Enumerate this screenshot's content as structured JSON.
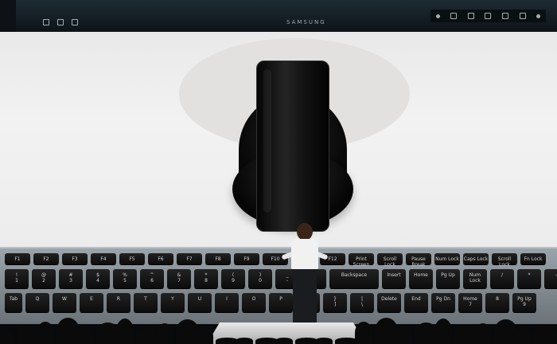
{
  "monitor": {
    "brand": "SAMSUNG"
  },
  "keyboard": {
    "function_row": [
      "F1",
      "F2",
      "F3",
      "F4",
      "F5",
      "F6",
      "F7",
      "F8",
      "F9",
      "F10",
      "F11",
      "F12",
      "Print Screen",
      "Scroll Lock",
      "Pause Break",
      "Num Lock",
      "Caps Lock",
      "Scroll Lock",
      "Fn Lock"
    ],
    "number_row": [
      "!\n1",
      "@\n2",
      "#\n3",
      "$\n4",
      "%\n5",
      "^\n6",
      "&\n7",
      "*\n8",
      "(\n9",
      ")\n0",
      "_\n-",
      "+\n=",
      "Backspace",
      "Insert",
      "Home",
      "Pg Up",
      "Num\nLock",
      "/",
      "*",
      "-"
    ],
    "letter_row": [
      "Tab",
      "Q",
      "W",
      "E",
      "R",
      "T",
      "Y",
      "U",
      "I",
      "O",
      "P",
      "{\n[",
      "}\n]",
      "|\n\\",
      "Delete",
      "End",
      "Pg Dn",
      "Home\n7",
      "8",
      "Pg Up\n9"
    ]
  }
}
